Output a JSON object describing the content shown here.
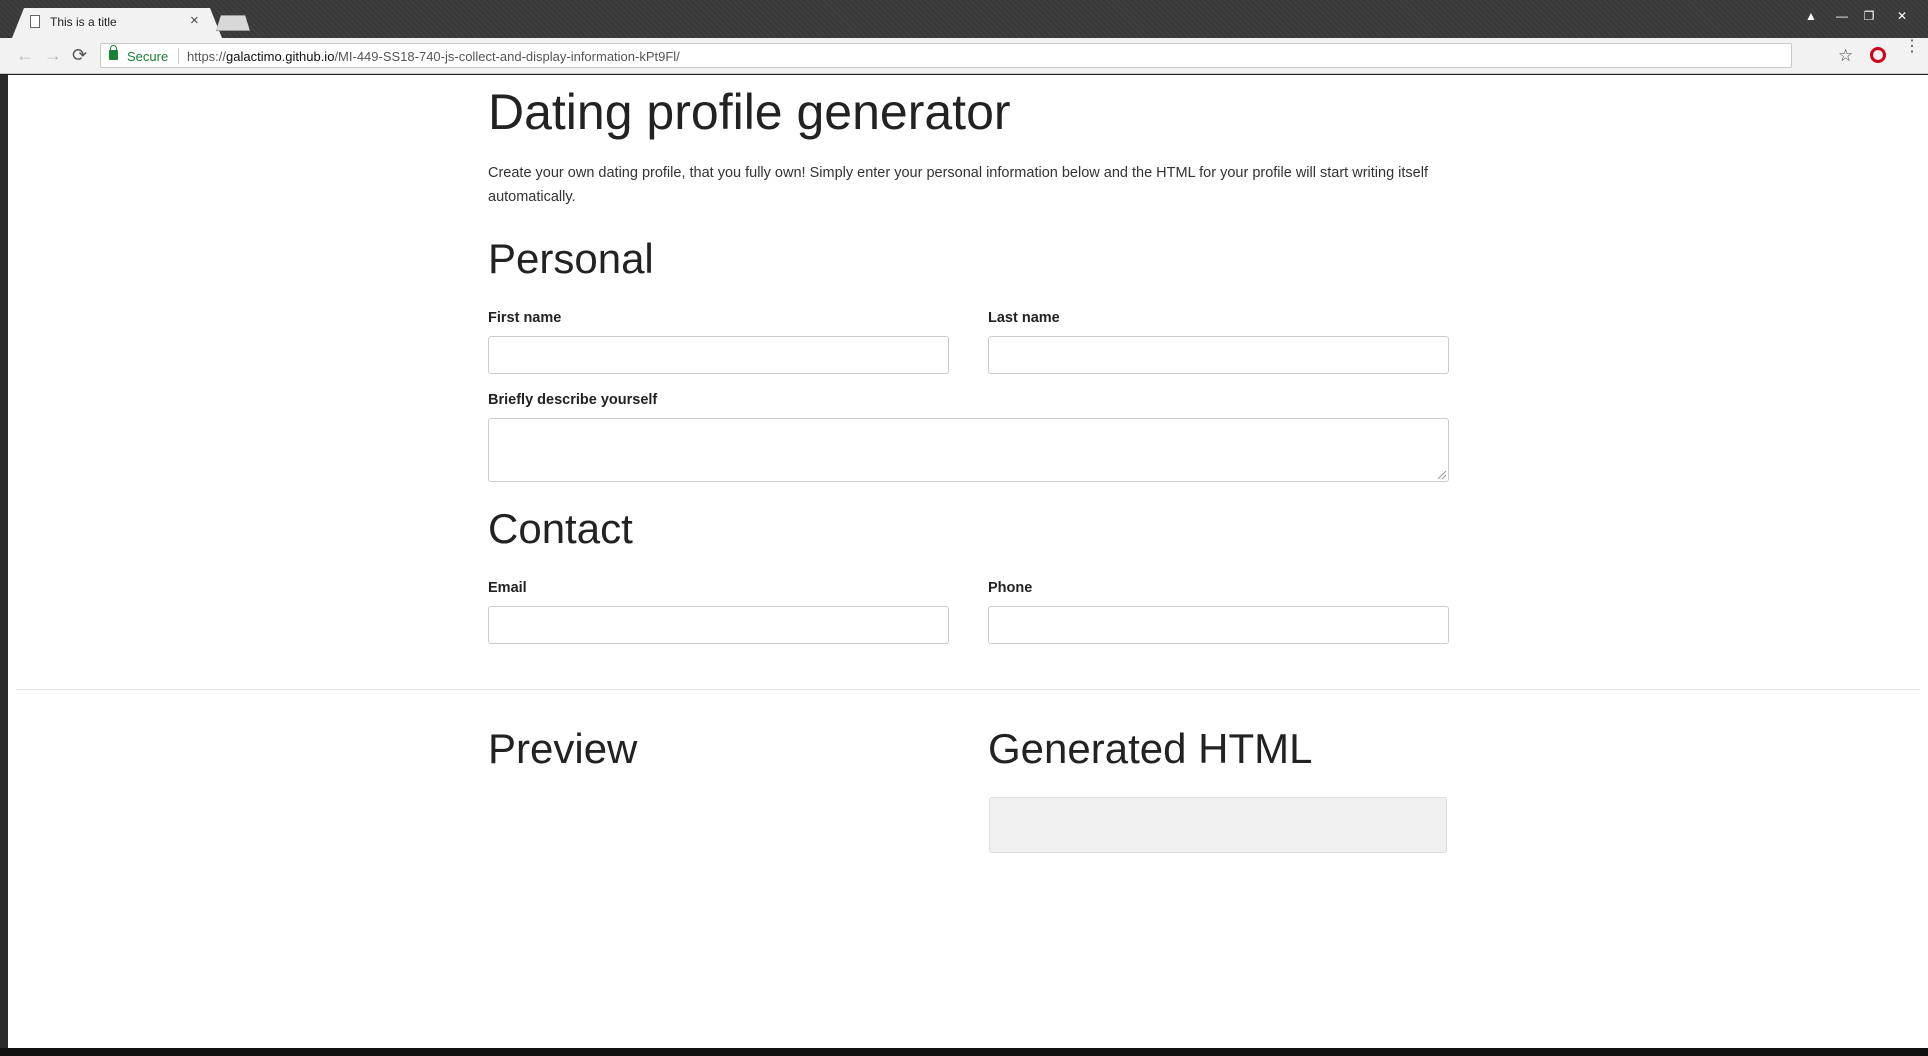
{
  "browser": {
    "tab_title": "This is a title",
    "tab_close": "×",
    "secure_label": "Secure",
    "url_scheme": "https://",
    "url_host": "galactimo.github.io",
    "url_path": "/MI-449-SS18-740-js-collect-and-display-information-kPt9Fl/",
    "back_glyph": "←",
    "forward_glyph": "→",
    "reload_glyph": "⟳",
    "star_glyph": "☆",
    "menu_glyph": "⋮",
    "min_glyph": "—",
    "max_glyph": "❐",
    "close_glyph": "✕",
    "user_glyph": "▲",
    "accent_secure": "#1a7f37"
  },
  "page": {
    "title": "Dating profile generator",
    "intro": "Create your own dating profile, that you fully own! Simply enter your personal information below and the HTML for your profile will start writing itself automatically.",
    "personal": {
      "heading": "Personal",
      "first_name_label": "First name",
      "first_name_value": "",
      "last_name_label": "Last name",
      "last_name_value": "",
      "describe_label": "Briefly describe yourself",
      "describe_value": ""
    },
    "contact": {
      "heading": "Contact",
      "email_label": "Email",
      "email_value": "",
      "phone_label": "Phone",
      "phone_value": ""
    },
    "preview_heading": "Preview",
    "generated_heading": "Generated HTML",
    "generated_code": ""
  }
}
